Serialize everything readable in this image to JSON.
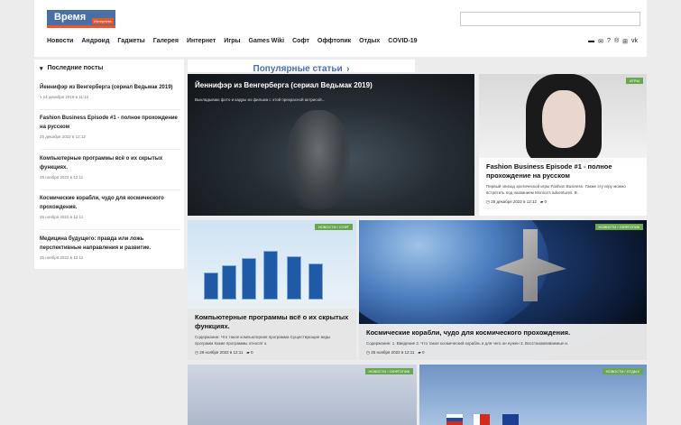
{
  "header": {
    "logo": {
      "main": "Время",
      "sub": "Интернета"
    },
    "nav": [
      "Новости",
      "Андроид",
      "Гаджеты",
      "Галерея",
      "Интернет",
      "Игры",
      "Games Wiki",
      "Софт",
      "Оффтопик",
      "Отдых",
      "COVID-19"
    ],
    "icons": [
      "card-icon",
      "mail-icon",
      "help-icon",
      "rss-icon",
      "share-icon",
      "vk-icon"
    ]
  },
  "sidebar": {
    "title": "Последние посты",
    "items": [
      {
        "title": "Йеннифэр из Венгерберга (сериал Ведьмак 2019)",
        "date": "24 декабря 2019 в 11:12"
      },
      {
        "title": "Fashion Business Episode #1 - полное прохождение на русском",
        "date": "25 декабря 2022 в 12:12"
      },
      {
        "title": "Компьютерные программы всё о их скрытых функциях.",
        "date": "29 ноября 2022 в 12:11"
      },
      {
        "title": "Космические корабли, чудо для космического прохождения.",
        "date": "25 ноября 2022 в 12:11"
      },
      {
        "title": "Медицина будущего: правда или ложь перспективные направления и развитие.",
        "date": "25 ноября 2022 в 12:11"
      }
    ]
  },
  "popular_title": "Популярные статьи",
  "cards": [
    {
      "title": "Йеннифэр из Венгерберга (сериал Ведьмак 2019)",
      "desc": "Выкладываю фото и кадры из фильма с этой прекрасной актрисой..."
    },
    {
      "badge": "Игры",
      "title": "Fashion Business Episode #1 - полное прохождение на русском",
      "desc": "Первый эпизод эротической игры Fashion Business. Также эту игру можно встретить под названием Monica's adventures. В.",
      "date": "25 декабря 2022 в 12:12",
      "comments": "0"
    },
    {
      "badge": "Новости / Софт",
      "title": "Компьютерные программы всё о их скрытых функциях.",
      "desc": "Содержание: Что такое компьютерная программа Существующие виды программ Какие программы относят к.",
      "date": "29 ноября 2022 в 12:11",
      "comments": "0"
    },
    {
      "badge": "Новости / Оффтопик",
      "title": "Космические корабли, чудо для космического прохождения.",
      "desc": "Содержание: 1. Введение 2. Что такое космический корабль и для чего он нужен 3. Восстанавливаемые и.",
      "date": "25 ноября 2022 в 12:11",
      "comments": "0"
    },
    {
      "badge": "Новости / Оффтопик"
    },
    {
      "badge": "Новости / Отдых"
    }
  ]
}
